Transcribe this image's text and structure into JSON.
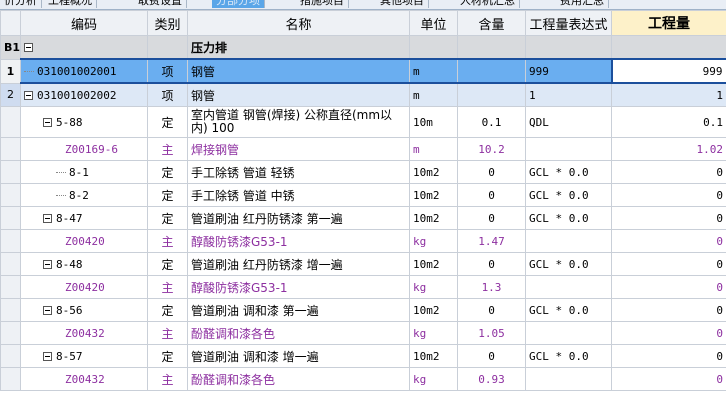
{
  "tabs": [
    "价分析",
    "工程概况",
    "取费设置",
    "分部分项",
    "措施项目",
    "其他项目",
    "人材机汇总",
    "费用汇总"
  ],
  "columns": {
    "row": "",
    "code": "编码",
    "type": "类别",
    "name": "名称",
    "unit": "单位",
    "content": "含量",
    "expr": "工程量表达式",
    "qty": "工程量"
  },
  "rows": [
    {
      "rh": "B1",
      "code": "",
      "type": "",
      "name": "压力排",
      "unit": "",
      "content": "",
      "expr": "",
      "qty": ""
    },
    {
      "rh": "1",
      "code": "031001002001",
      "type": "项",
      "name": "钢管",
      "unit": "m",
      "content": "",
      "expr": "999",
      "qty": "999"
    },
    {
      "rh": "2",
      "code": "031001002002",
      "type": "项",
      "name": "钢管",
      "unit": "m",
      "content": "",
      "expr": "1",
      "qty": "1"
    },
    {
      "rh": "",
      "code": "5-88",
      "type": "定",
      "name": "室内管道 钢管(焊接) 公称直径(mm以内) 100",
      "unit": "10m",
      "content": "0.1",
      "expr": "QDL",
      "qty": "0.1"
    },
    {
      "rh": "",
      "code": "Z00169-6",
      "type": "主",
      "name": "焊接钢管",
      "unit": "m",
      "content": "10.2",
      "expr": "",
      "qty": "1.02"
    },
    {
      "rh": "",
      "code": "8-1",
      "type": "定",
      "name": "手工除锈 管道 轻锈",
      "unit": "10m2",
      "content": "0",
      "expr": "GCL * 0.0",
      "qty": "0"
    },
    {
      "rh": "",
      "code": "8-2",
      "type": "定",
      "name": "手工除锈 管道 中锈",
      "unit": "10m2",
      "content": "0",
      "expr": "GCL * 0.0",
      "qty": "0"
    },
    {
      "rh": "",
      "code": "8-47",
      "type": "定",
      "name": "管道刷油 红丹防锈漆 第一遍",
      "unit": "10m2",
      "content": "0",
      "expr": "GCL * 0.0",
      "qty": "0"
    },
    {
      "rh": "",
      "code": "Z00420",
      "type": "主",
      "name": "醇酸防锈漆G53-1",
      "unit": "kg",
      "content": "1.47",
      "expr": "",
      "qty": "0"
    },
    {
      "rh": "",
      "code": "8-48",
      "type": "定",
      "name": "管道刷油 红丹防锈漆 增一遍",
      "unit": "10m2",
      "content": "0",
      "expr": "GCL * 0.0",
      "qty": "0"
    },
    {
      "rh": "",
      "code": "Z00420",
      "type": "主",
      "name": "醇酸防锈漆G53-1",
      "unit": "kg",
      "content": "1.3",
      "expr": "",
      "qty": "0"
    },
    {
      "rh": "",
      "code": "8-56",
      "type": "定",
      "name": "管道刷油 调和漆 第一遍",
      "unit": "10m2",
      "content": "0",
      "expr": "GCL * 0.0",
      "qty": "0"
    },
    {
      "rh": "",
      "code": "Z00432",
      "type": "主",
      "name": "酚醛调和漆各色",
      "unit": "kg",
      "content": "1.05",
      "expr": "",
      "qty": "0"
    },
    {
      "rh": "",
      "code": "8-57",
      "type": "定",
      "name": "管道刷油 调和漆 增一遍",
      "unit": "10m2",
      "content": "0",
      "expr": "GCL * 0.0",
      "qty": "0"
    },
    {
      "rh": "",
      "code": "Z00432",
      "type": "主",
      "name": "酚醛调和漆各色",
      "unit": "kg",
      "content": "0.93",
      "expr": "",
      "qty": "0"
    }
  ],
  "colors": {
    "selected_row": "#6aaef0",
    "material_text": "#8d2fa0",
    "highlight_header": "#fdf1c9"
  }
}
